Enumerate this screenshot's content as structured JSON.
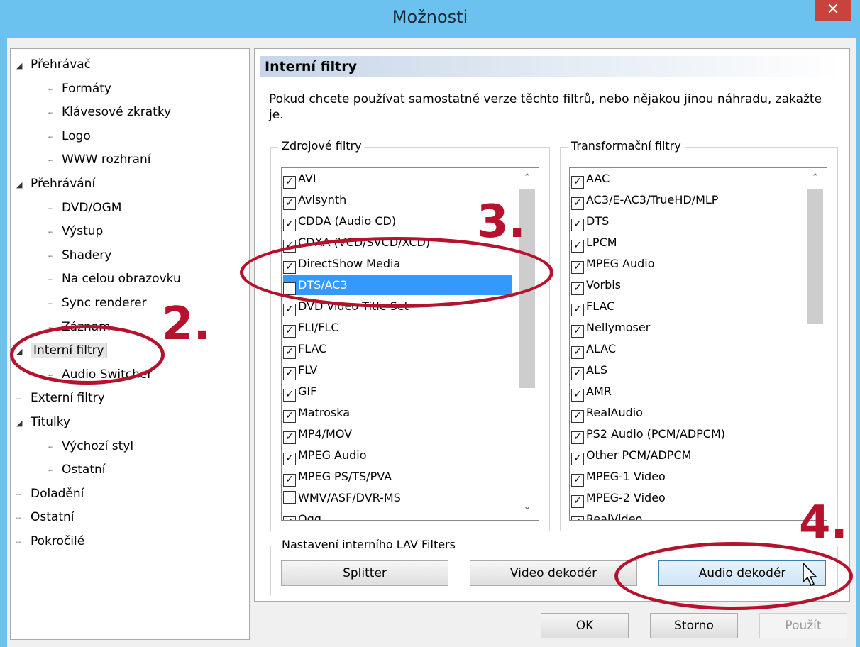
{
  "window": {
    "title": "Možnosti",
    "close_glyph": "✕"
  },
  "tree": {
    "items": [
      {
        "label": "Přehrávač",
        "level": 0,
        "expander": "◢"
      },
      {
        "label": "Formáty",
        "level": 1
      },
      {
        "label": "Klávesové zkratky",
        "level": 1
      },
      {
        "label": "Logo",
        "level": 1
      },
      {
        "label": "WWW rozhraní",
        "level": 1
      },
      {
        "label": "Přehrávání",
        "level": 0,
        "expander": "◢"
      },
      {
        "label": "DVD/OGM",
        "level": 1
      },
      {
        "label": "Výstup",
        "level": 1
      },
      {
        "label": "Shadery",
        "level": 1
      },
      {
        "label": "Na celou obrazovku",
        "level": 1
      },
      {
        "label": "Sync renderer",
        "level": 1
      },
      {
        "label": "Záznam",
        "level": 1
      },
      {
        "label": "Interní filtry",
        "level": 0,
        "expander": "◢",
        "selected": true
      },
      {
        "label": "Audio Switcher",
        "level": 1
      },
      {
        "label": "Externí filtry",
        "level": 0
      },
      {
        "label": "Titulky",
        "level": 0,
        "expander": "◢"
      },
      {
        "label": "Výchozí styl",
        "level": 1
      },
      {
        "label": "Ostatní",
        "level": 1
      },
      {
        "label": "Doladění",
        "level": 0
      },
      {
        "label": "Ostatní",
        "level": 0
      },
      {
        "label": "Pokročilé",
        "level": 0
      }
    ]
  },
  "panel": {
    "header": "Interní filtry",
    "description": "Pokud chcete používat samostatné verze těchto filtrů, nebo nějakou jinou náhradu, zakažte je.",
    "source_filters": {
      "title": "Zdrojové filtry",
      "items": [
        {
          "label": "AVI",
          "checked": true
        },
        {
          "label": "Avisynth",
          "checked": true
        },
        {
          "label": "CDDA (Audio CD)",
          "checked": true
        },
        {
          "label": "CDXA (VCD/SVCD/XCD)",
          "checked": true
        },
        {
          "label": "DirectShow Media",
          "checked": true
        },
        {
          "label": "DTS/AC3",
          "checked": true,
          "selected": true
        },
        {
          "label": "DVD Video Title Set",
          "checked": true
        },
        {
          "label": "FLI/FLC",
          "checked": true
        },
        {
          "label": "FLAC",
          "checked": true
        },
        {
          "label": "FLV",
          "checked": true
        },
        {
          "label": "GIF",
          "checked": true
        },
        {
          "label": "Matroska",
          "checked": true
        },
        {
          "label": "MP4/MOV",
          "checked": true
        },
        {
          "label": "MPEG Audio",
          "checked": true
        },
        {
          "label": "MPEG PS/TS/PVA",
          "checked": true
        },
        {
          "label": "WMV/ASF/DVR-MS",
          "checked": false
        },
        {
          "label": "Ogg",
          "checked": true
        }
      ]
    },
    "transform_filters": {
      "title": "Transformační filtry",
      "items": [
        {
          "label": "AAC",
          "checked": true
        },
        {
          "label": "AC3/E-AC3/TrueHD/MLP",
          "checked": true
        },
        {
          "label": "DTS",
          "checked": true
        },
        {
          "label": "LPCM",
          "checked": true
        },
        {
          "label": "MPEG Audio",
          "checked": true
        },
        {
          "label": "Vorbis",
          "checked": true
        },
        {
          "label": "FLAC",
          "checked": true
        },
        {
          "label": "Nellymoser",
          "checked": true
        },
        {
          "label": "ALAC",
          "checked": true
        },
        {
          "label": "ALS",
          "checked": true
        },
        {
          "label": "AMR",
          "checked": true
        },
        {
          "label": "RealAudio",
          "checked": true
        },
        {
          "label": "PS2 Audio (PCM/ADPCM)",
          "checked": true
        },
        {
          "label": "Other PCM/ADPCM",
          "checked": true
        },
        {
          "label": "MPEG-1 Video",
          "checked": true
        },
        {
          "label": "MPEG-2 Video",
          "checked": true
        },
        {
          "label": "RealVideo",
          "checked": true
        }
      ]
    },
    "lav": {
      "title": "Nastavení interního LAV Filters",
      "splitter": "Splitter",
      "video": "Video dekodér",
      "audio": "Audio dekodér"
    }
  },
  "footer": {
    "ok": "OK",
    "cancel": "Storno",
    "apply": "Použít"
  },
  "annotations": {
    "n2": "2.",
    "n3": "3.",
    "n4": "4."
  },
  "colors": {
    "accent": "#b5122d",
    "selection": "#3399ff",
    "titlebar": "#6cc2ee"
  }
}
